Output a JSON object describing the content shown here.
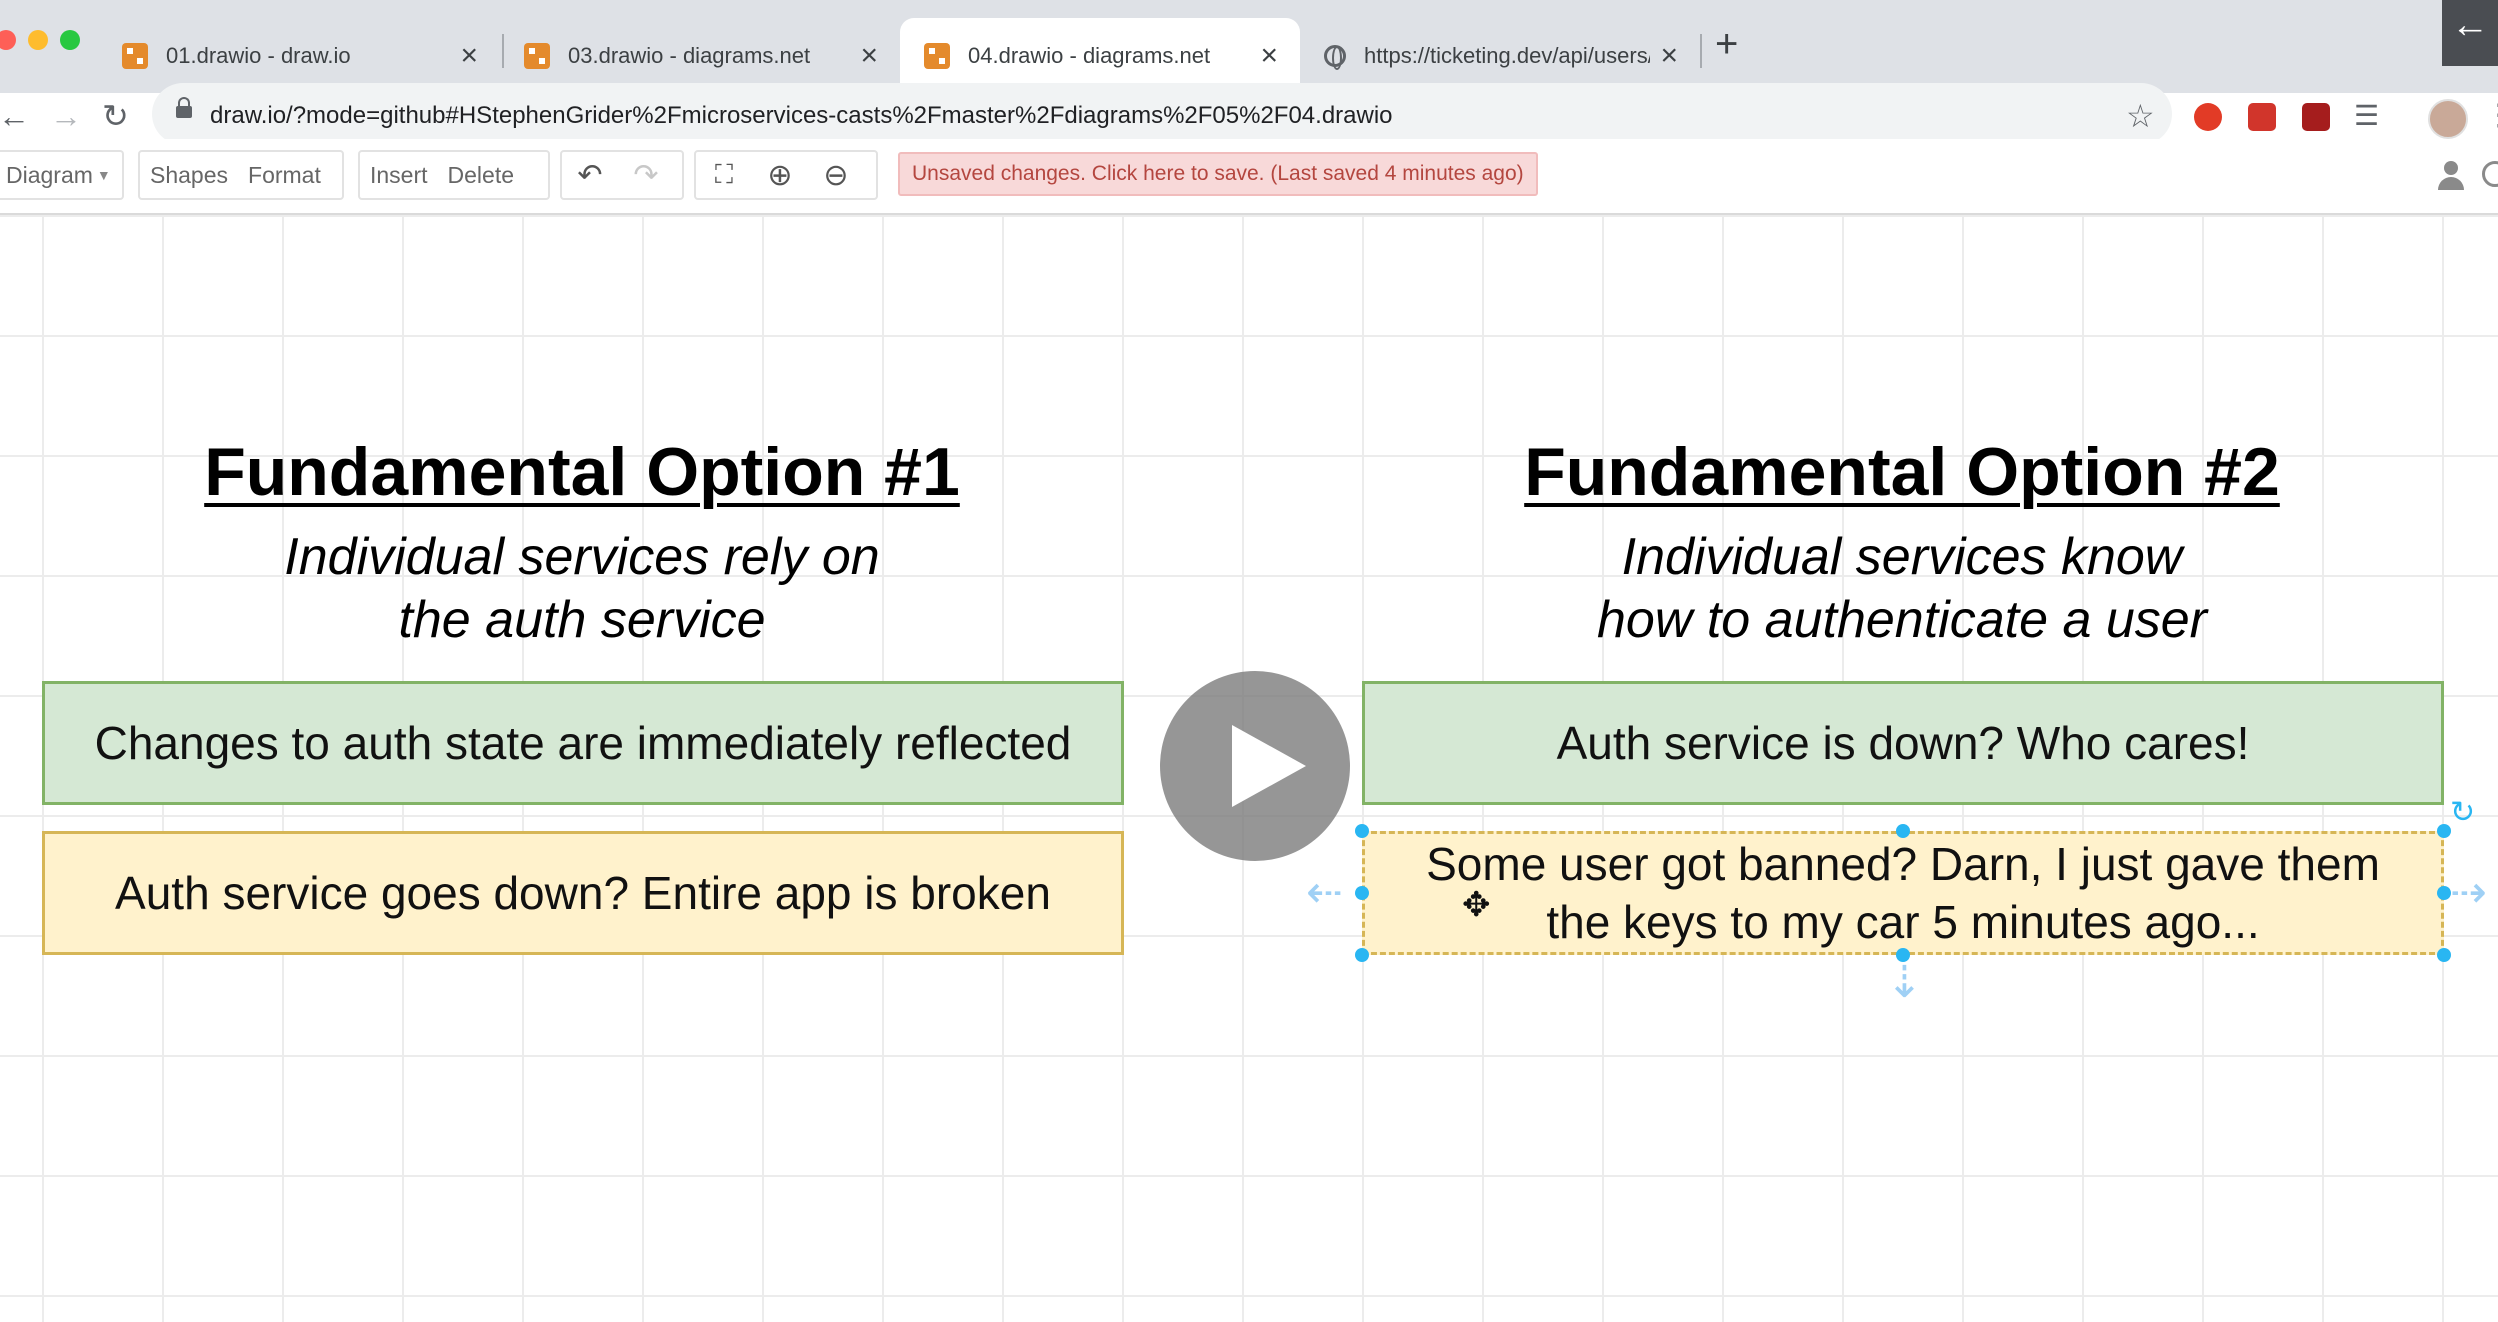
{
  "browser": {
    "tabs": [
      {
        "label": "01.drawio - draw.io",
        "icon": "drawio-favicon-icon",
        "active": false
      },
      {
        "label": "03.drawio - diagrams.net",
        "icon": "drawio-favicon-icon",
        "active": false
      },
      {
        "label": "04.drawio - diagrams.net",
        "icon": "drawio-favicon-icon",
        "active": true
      },
      {
        "label": "https://ticketing.dev/api/users/c",
        "icon": "globe-icon",
        "active": false
      }
    ],
    "new_tab_label": "+",
    "close_glyph": "×",
    "url": "draw.io/?mode=github#HStephenGrider%2Fmicroservices-casts%2Fmaster%2Fdiagrams%2F05%2F04.drawio"
  },
  "toolbar": {
    "diagram_menu": "Diagram",
    "shapes": "Shapes",
    "format": "Format",
    "insert": "Insert",
    "delete": "Delete",
    "save_notice": "Unsaved changes. Click here to save. (Last saved 4 minutes ago)"
  },
  "diagram": {
    "option1": {
      "title": "Fundamental Option #1",
      "subtitle_line1": "Individual services rely on",
      "subtitle_line2": "the auth service",
      "pro": "Changes to auth state are immediately reflected",
      "con": "Auth service goes down?  Entire app is broken"
    },
    "option2": {
      "title": "Fundamental Option #2",
      "subtitle_line1": "Individual services know",
      "subtitle_line2": "how to authenticate a user",
      "pro": "Auth service is down? Who cares!",
      "con_line1": "Some user got banned? Darn, I just gave them",
      "con_line2": "the keys to my car 5 minutes ago..."
    }
  },
  "colors": {
    "green_fill": "#d5e8d4",
    "green_border": "#82b366",
    "yellow_fill": "#fff2cc",
    "yellow_border": "#d6b656",
    "selection_handle": "#29b6f2",
    "save_notice_bg": "#f8d9d9"
  }
}
